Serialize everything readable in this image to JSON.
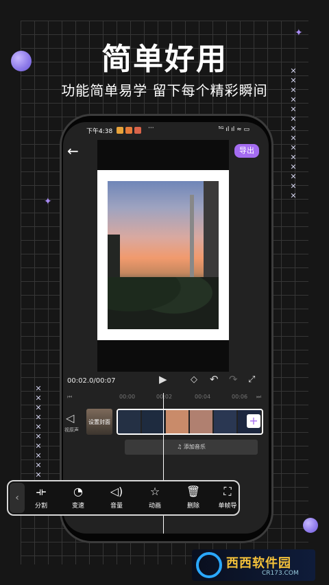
{
  "headline": "简单好用",
  "subline": "功能简单易学  留下每个精彩瞬间",
  "colors": {
    "accent": "#a46cf0",
    "background": "#161616"
  },
  "status_bar": {
    "time": "下午4:38",
    "dots": "···",
    "right": "⁵ᴳ ıl ıl ≈ ▭"
  },
  "editor": {
    "back_icon": "back-arrow-icon",
    "export_label": "导出",
    "timecode": "00:02.0/00:07",
    "ruler": [
      "00:00",
      "00:02",
      "00:04",
      "00:06"
    ],
    "mute_label": "视原声",
    "cover_label": "设置封面",
    "add_music_label": "♫ 添加音乐"
  },
  "toolbar": {
    "items": [
      {
        "label": "分割",
        "icon": "split-icon"
      },
      {
        "label": "变速",
        "icon": "speed-icon"
      },
      {
        "label": "音量",
        "icon": "volume-icon"
      },
      {
        "label": "动画",
        "icon": "animation-icon"
      },
      {
        "label": "删除",
        "icon": "delete-icon"
      },
      {
        "label": "单帧导",
        "icon": "frame-export-icon"
      }
    ]
  },
  "watermark": {
    "name": "西西软件园",
    "url": "CR173.COM"
  }
}
